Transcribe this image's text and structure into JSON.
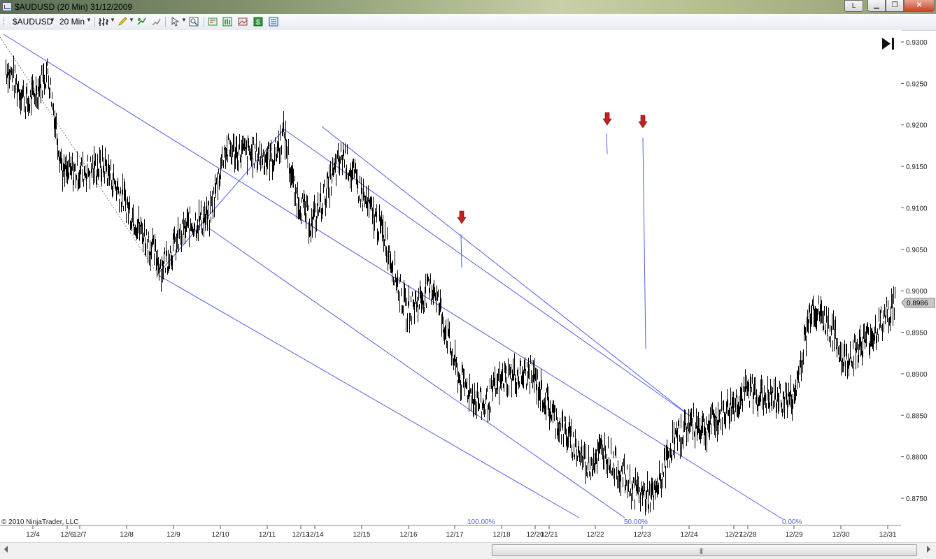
{
  "window": {
    "title": "$AUDUSD (20 Min)  31/12/2009",
    "buttons": {
      "link": "L",
      "minimize": "▁",
      "maximize": "❐",
      "close": "✕"
    }
  },
  "toolbar": {
    "instrument": "$AUDUSD",
    "interval": "20 Min",
    "icons": [
      "bar-type-icon",
      "drawing-pencil-icon",
      "add-indicator-icon",
      "strategy-icon",
      "cursor-icon",
      "zoom-icon",
      "properties-icon",
      "chart-trader-icon",
      "snapshot-icon",
      "money-icon",
      "data-box-icon"
    ]
  },
  "chart": {
    "copyright": "© 2010 NinjaTrader, LLC",
    "current_price_label": "0.8986",
    "colors": {
      "price_bars": "#000000",
      "channel_lines": "#4f5fe8",
      "arrow": "#c81e1e",
      "axis_text": "#222222"
    },
    "fib_labels": [
      "100.00%",
      "50.00%",
      "0.00%"
    ]
  },
  "chart_data": {
    "type": "bar",
    "instrument": "$AUDUSD",
    "interval": "20 Min",
    "y_axis_ticks": [
      "0.9300",
      "0.9250",
      "0.9200",
      "0.9150",
      "0.9100",
      "0.9050",
      "0.9000",
      "0.8950",
      "0.8900",
      "0.8850",
      "0.8800",
      "0.8750"
    ],
    "ylim": [
      0.873,
      0.931
    ],
    "x_axis_ticks": [
      "12/4",
      "12/6",
      "12/7",
      "12/8",
      "12/9",
      "12/10",
      "12/11",
      "12/13",
      "12/14",
      "12/15",
      "12/16",
      "12/17",
      "12/18",
      "12/20",
      "12/21",
      "12/22",
      "12/23",
      "12/24",
      "12/27",
      "12/28",
      "12/29",
      "12/30",
      "12/31"
    ],
    "last_price": 0.8986,
    "price_path_approx": [
      {
        "date": "12/4",
        "close": 0.927
      },
      {
        "date": "12/4",
        "close": 0.9225
      },
      {
        "date": "12/6",
        "close": 0.9265
      },
      {
        "date": "12/7",
        "close": 0.914
      },
      {
        "date": "12/8",
        "close": 0.915
      },
      {
        "date": "12/9",
        "close": 0.903
      },
      {
        "date": "12/9",
        "close": 0.908
      },
      {
        "date": "12/10",
        "close": 0.909
      },
      {
        "date": "12/10",
        "close": 0.917
      },
      {
        "date": "12/11",
        "close": 0.916
      },
      {
        "date": "12/13",
        "close": 0.919
      },
      {
        "date": "12/14",
        "close": 0.912
      },
      {
        "date": "12/14",
        "close": 0.908
      },
      {
        "date": "12/15",
        "close": 0.9165
      },
      {
        "date": "12/15",
        "close": 0.911
      },
      {
        "date": "12/16",
        "close": 0.9065
      },
      {
        "date": "12/16",
        "close": 0.8975
      },
      {
        "date": "12/17",
        "close": 0.9005
      },
      {
        "date": "12/17",
        "close": 0.8895
      },
      {
        "date": "12/18",
        "close": 0.886
      },
      {
        "date": "12/18",
        "close": 0.8895
      },
      {
        "date": "12/20",
        "close": 0.89
      },
      {
        "date": "12/21",
        "close": 0.885
      },
      {
        "date": "12/22",
        "close": 0.879
      },
      {
        "date": "12/22",
        "close": 0.881
      },
      {
        "date": "12/23",
        "close": 0.876
      },
      {
        "date": "12/23",
        "close": 0.875
      },
      {
        "date": "12/24",
        "close": 0.8815
      },
      {
        "date": "12/24",
        "close": 0.884
      },
      {
        "date": "12/27",
        "close": 0.8835
      },
      {
        "date": "12/28",
        "close": 0.888
      },
      {
        "date": "12/28",
        "close": 0.887
      },
      {
        "date": "12/29",
        "close": 0.887
      },
      {
        "date": "12/29",
        "close": 0.8985
      },
      {
        "date": "12/30",
        "close": 0.895
      },
      {
        "date": "12/30",
        "close": 0.8915
      },
      {
        "date": "12/31",
        "close": 0.895
      },
      {
        "date": "12/31",
        "close": 0.8986
      }
    ],
    "annotations": [
      "100.00%",
      "50.00%",
      "0.00%"
    ],
    "grid": false
  }
}
